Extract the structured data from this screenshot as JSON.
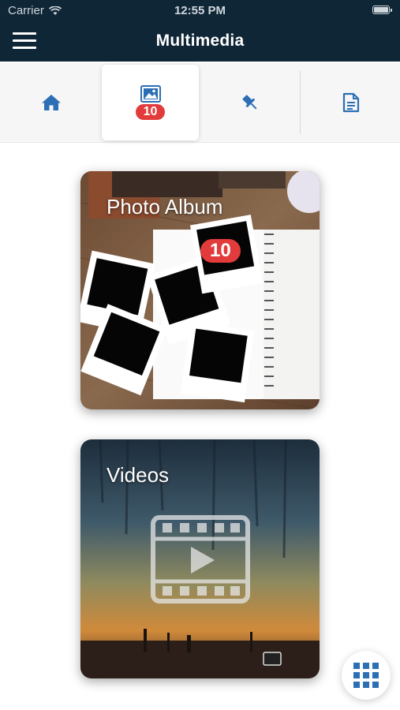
{
  "status_bar": {
    "carrier": "Carrier",
    "time": "12:55 PM"
  },
  "header": {
    "title": "Multimedia",
    "background": "#0f2636"
  },
  "tabs": [
    {
      "name": "home",
      "icon": "home-icon",
      "active": false
    },
    {
      "name": "photos",
      "icon": "image-icon",
      "badge": "10",
      "active": true
    },
    {
      "name": "pinned",
      "icon": "pin-icon",
      "active": false
    },
    {
      "name": "documents",
      "icon": "document-icon",
      "active": false
    }
  ],
  "cards": [
    {
      "label": "Photo Album",
      "badge": "10"
    },
    {
      "label": "Videos"
    }
  ],
  "colors": {
    "accent_blue": "#2c6fb5",
    "badge_red": "#e23b3b"
  },
  "fab": {
    "icon": "grid-icon"
  }
}
